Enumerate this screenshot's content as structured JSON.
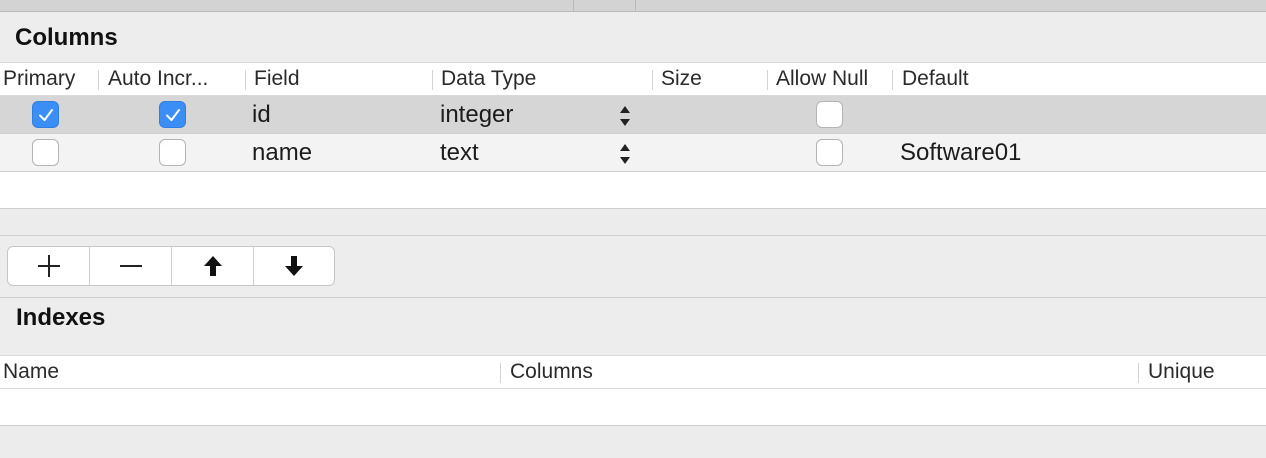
{
  "columns_section": {
    "title": "Columns",
    "headers": [
      "Primary",
      "Auto Incr...",
      "Field",
      "Data Type",
      "Size",
      "Allow Null",
      "Default"
    ],
    "rows": [
      {
        "primary": true,
        "auto_increment": true,
        "field": "id",
        "data_type": "integer",
        "size": "",
        "allow_null": false,
        "default": ""
      },
      {
        "primary": false,
        "auto_increment": false,
        "field": "name",
        "data_type": "text",
        "size": "",
        "allow_null": false,
        "default": "Software01"
      }
    ]
  },
  "toolbar": {
    "buttons": [
      {
        "icon": "plus-icon"
      },
      {
        "icon": "minus-icon"
      },
      {
        "icon": "arrow-up-icon"
      },
      {
        "icon": "arrow-down-icon"
      }
    ]
  },
  "indexes_section": {
    "title": "Indexes",
    "headers": [
      "Name",
      "Columns",
      "Unique"
    ]
  },
  "colors": {
    "checkbox_checked": "#3a8ef5",
    "selected_row": "#d6d6d6",
    "window_bg": "#ededed"
  }
}
